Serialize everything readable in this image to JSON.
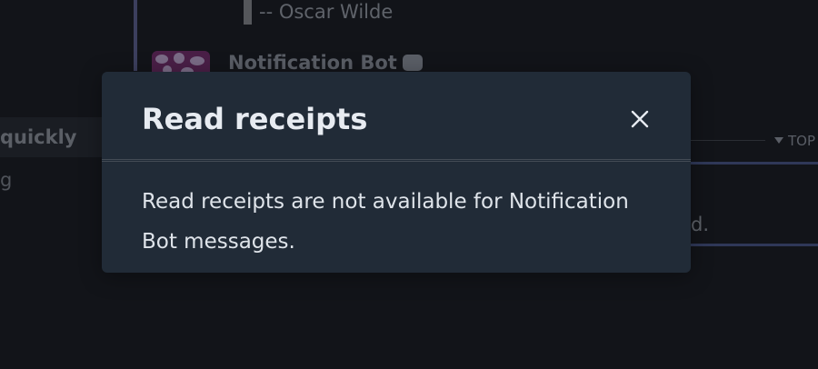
{
  "background": {
    "quote_attribution": "-- Oscar Wilde",
    "message_sender": "Notification Bot",
    "sender_icon": "robot-icon",
    "sidebar_item_1": "quickly",
    "sidebar_item_2": "g",
    "topic_label": "TOP",
    "compose_text": "d."
  },
  "modal": {
    "title": "Read receipts",
    "close_icon": "close-icon",
    "body": "Read receipts are not available for Notification Bot messages."
  },
  "colors": {
    "app_background": "#121419",
    "modal_background": "#212b37",
    "modal_title": "#e7ebf1",
    "modal_body": "#dfe4ea"
  }
}
